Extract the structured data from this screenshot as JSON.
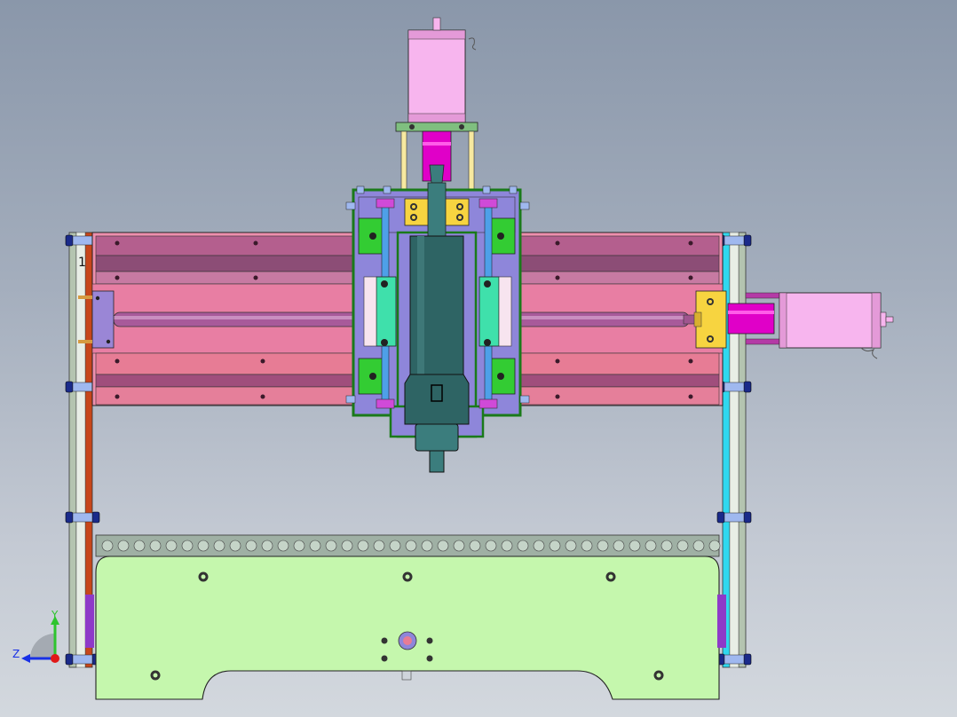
{
  "viewport": {
    "background_top": "#8a97aa",
    "background_bottom": "#d3d8de"
  },
  "model": {
    "colors": {
      "carriage_plate": "#ee8fae",
      "carriage_band": "#8c4d76",
      "spindle_head": "#2e6464",
      "stepper_motor": "#f7b5ee",
      "coupler": "#e000c8",
      "gantry_block": "#8e86da",
      "green_block": "#33cc33",
      "cyan_block": "#3fe0ab",
      "yellow_bracket": "#f7d440",
      "base_plate": "#c5f7ad",
      "aluminum_profile": "#9fb0a4",
      "left_frame": "#c7461a",
      "right_frame": "#2fd8ef",
      "rail": "#4ea0e8"
    },
    "part_label": "1"
  },
  "triad": {
    "y_label": "Y",
    "z_label": "Z",
    "y_color": "#2ec42e",
    "z_color": "#1830e6",
    "origin_color": "#e01818"
  }
}
